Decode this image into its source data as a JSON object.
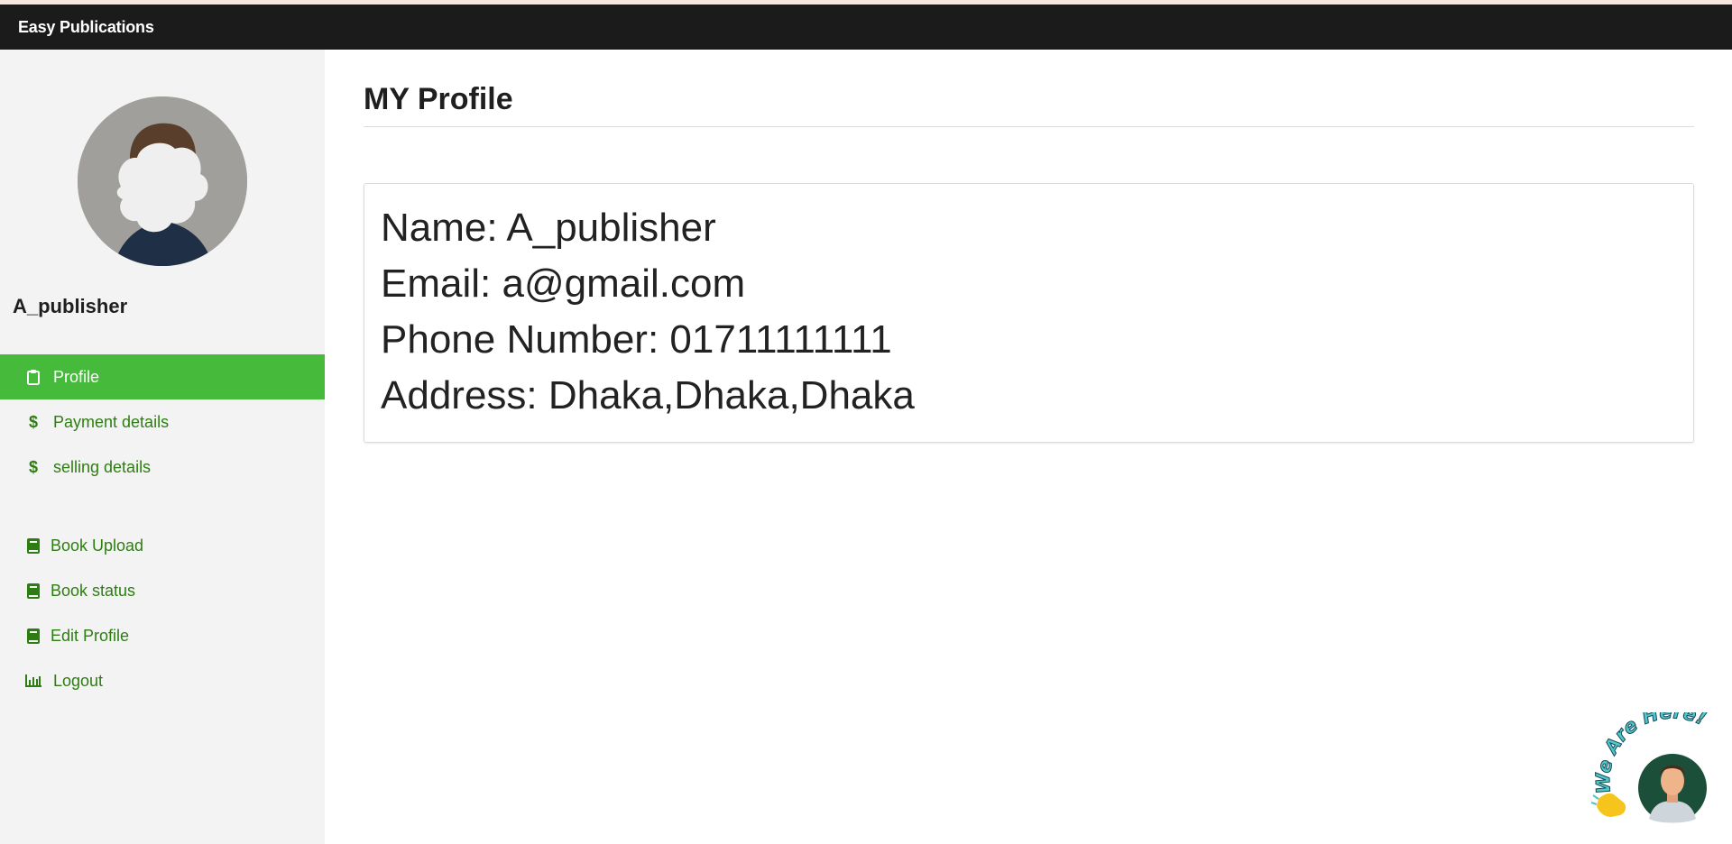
{
  "navbar": {
    "brand": "Easy Publications"
  },
  "sidebar": {
    "username": "A_publisher",
    "items": [
      {
        "label": "Profile",
        "icon": "clipboard-icon",
        "active": true
      },
      {
        "label": "Payment details",
        "icon": "dollar-icon"
      },
      {
        "label": "selling details",
        "icon": "dollar-icon"
      },
      {
        "label": "Book Upload",
        "icon": "book-icon"
      },
      {
        "label": "Book status",
        "icon": "book-icon"
      },
      {
        "label": "Edit Profile",
        "icon": "book-icon"
      },
      {
        "label": "Logout",
        "icon": "bar-chart-icon"
      }
    ]
  },
  "main": {
    "title": "MY Profile",
    "profile": {
      "name_line": "Name: A_publisher",
      "email_line": "Email: a@gmail.com",
      "phone_line": "Phone Number: 01711111111",
      "address_line": "Address: Dhaka,Dhaka,Dhaka"
    }
  },
  "chat_widget": {
    "text": "We Are Here!",
    "icon": "waving-hand-icon"
  },
  "colors": {
    "accent": "#46bb3b",
    "link": "#2e7d12",
    "navbar": "#1b1b1b",
    "sidebar": "#f3f3f3"
  }
}
